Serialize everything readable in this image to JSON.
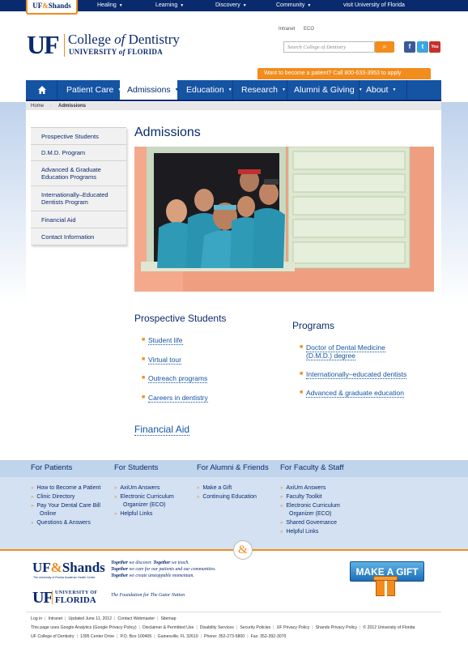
{
  "topbar": {
    "shands": {
      "uf": "UF",
      "amp": "&",
      "shands": "Shands"
    },
    "items": [
      {
        "label": "Healing"
      },
      {
        "label": "Learning"
      },
      {
        "label": "Discovery"
      },
      {
        "label": "Community"
      }
    ],
    "visit_label": "visit University of Florida"
  },
  "header": {
    "uf_mark": "UF",
    "college_pre": "College ",
    "college_of": "of",
    "college_post": " Dentistry",
    "univ_pre": "UNIVERSITY ",
    "univ_of": "of",
    "univ_post": " FLORIDA",
    "util_links": [
      "Intranet",
      "ECO"
    ],
    "search_placeholder": "Search College of Dentistry",
    "social": [
      {
        "name": "facebook-icon",
        "glyph": "f",
        "color": "#3b5998"
      },
      {
        "name": "twitter-icon",
        "glyph": "t",
        "color": "#3aa6e0"
      },
      {
        "name": "youtube-icon",
        "glyph": "You",
        "color": "#c4302b"
      }
    ],
    "patient_bar": "Want to become a patient? Call 800-633-3953 to apply"
  },
  "nav": {
    "items": [
      {
        "label": "Patient Care"
      },
      {
        "label": "Admissions"
      },
      {
        "label": "Education"
      },
      {
        "label": "Research"
      },
      {
        "label": "Alumni & Giving"
      },
      {
        "label": "About"
      }
    ]
  },
  "breadcrumb": [
    "Home",
    "Admissions"
  ],
  "sidebar": {
    "items": [
      {
        "label": "Prospective Students"
      },
      {
        "label": "D.M.D. Program"
      },
      {
        "label": "Advanced & Graduate Education Programs"
      },
      {
        "label": "Internationally–Educated Dentists Program"
      },
      {
        "label": "Financial Aid"
      },
      {
        "label": "Contact Information"
      }
    ]
  },
  "main": {
    "title": "Admissions",
    "prospective": {
      "heading": "Prospective Students",
      "links": [
        "Student life",
        "Virtual tour",
        "Outreach programs",
        "Careers in dentistry"
      ]
    },
    "programs": {
      "heading": "Programs",
      "links": [
        "Doctor of Dental Medicine (D.M.D.) degree",
        "Internationally–educated dentists",
        "Advanced & graduate education"
      ]
    },
    "financial_aid": "Financial Aid"
  },
  "footer_links": {
    "columns": [
      {
        "heading": "For Patients",
        "links": [
          "How to Become a Patient",
          "Clinic Directory",
          "Pay Your Dental Care Bill Online",
          "Questions & Answers"
        ]
      },
      {
        "heading": "For Students",
        "links": [
          "AxiUm Answers",
          "Electronic Curriculum Organizer (ECO)",
          "Helpful Links"
        ]
      },
      {
        "heading": "For Alumni & Friends",
        "links": [
          "Make a Gift",
          "Continuing Education"
        ]
      },
      {
        "heading": "For Faculty & Staff",
        "links": [
          "AxiUm Answers",
          "Faculty Toolkit",
          "Electronic Curriculum Organizer (ECO)",
          "Shared Governance",
          "Helpful Links"
        ]
      }
    ]
  },
  "footer": {
    "amp": "&",
    "shands_uf": "UF",
    "shands_amp": "&",
    "shands_name": "Shands",
    "shands_sub": "The University of Florida Academic Health Center",
    "tagline": [
      {
        "bold": "Together",
        "rest": " we discover. ",
        "bold2": "Together",
        "rest2": " we teach."
      },
      {
        "bold": "Together",
        "rest": " we care for our patients and our communities.",
        "bold2": "",
        "rest2": ""
      },
      {
        "bold": "Together",
        "rest": " we create unstoppable momentum.",
        "bold2": "",
        "rest2": ""
      }
    ],
    "uf_mark": "UF",
    "uf_univ": "UNIVERSITY OF",
    "uf_florida": "FLORIDA",
    "gator_nation": "The Foundation for The Gator Nation",
    "gift_label": "MAKE A GIFT",
    "bottom_row1": [
      "Log in",
      "Intranet",
      "Updated June 11, 2012",
      "Contact Webmaster",
      "Sitemap"
    ],
    "bottom_row2": [
      "This page uses Google Analytics (Google Privacy Policy)",
      "Disclaimer & Permitted Use",
      "Disability Services",
      "Security Policies",
      "UF Privacy Policy",
      "Shands Privacy Policy",
      "© 2012 University of Florida"
    ],
    "bottom_row3": [
      "UF College of Dentistry",
      "1395 Center Drive",
      "P.O. Box 100405",
      "Gainesville, FL 32610",
      "Phone: 352-273-5800",
      "Fax: 352-392-3070"
    ]
  }
}
